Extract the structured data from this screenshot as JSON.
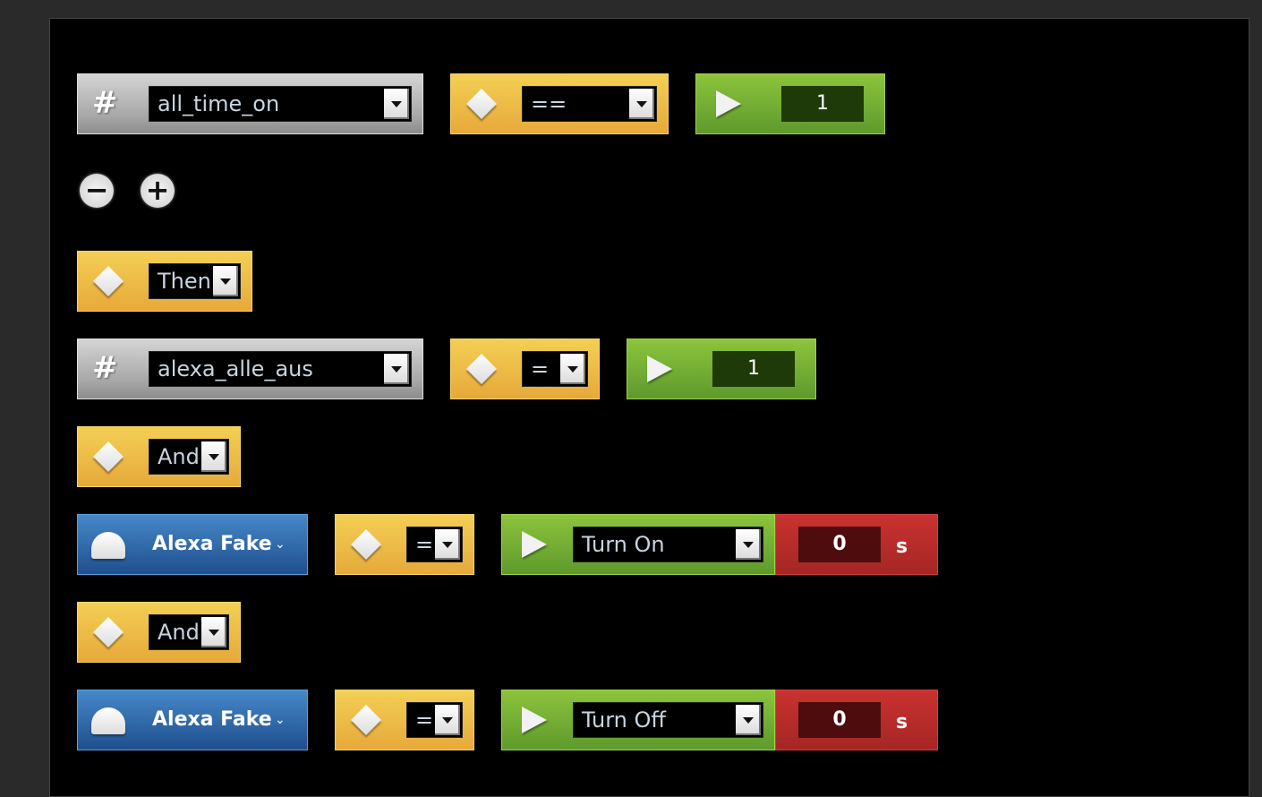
{
  "rows": [
    {
      "type": "condition",
      "variable": "all_time_on",
      "operator": "==",
      "value": "1"
    },
    {
      "type": "logic",
      "value": "Then"
    },
    {
      "type": "condition",
      "variable": "alexa_alle_aus",
      "operator": "=",
      "value": "1"
    },
    {
      "type": "logic",
      "value": "And"
    },
    {
      "type": "device",
      "device": "Alexa Fake",
      "operator": "=",
      "action": "Turn On",
      "delay": "0",
      "unit": "s"
    },
    {
      "type": "logic",
      "value": "And"
    },
    {
      "type": "device",
      "device": "Alexa Fake",
      "operator": "=",
      "action": "Turn Off",
      "delay": "0",
      "unit": "s"
    }
  ],
  "controls": {
    "remove": "−",
    "add": "+"
  },
  "icons": {
    "variable": "hash-icon",
    "operator": "diamond-icon",
    "value": "play-icon",
    "device": "dome-icon"
  },
  "colors": {
    "gray": "#b0b0b0",
    "yellow": "#eebc48",
    "green": "#76b034",
    "red": "#b82c2a",
    "blue": "#2e69ab"
  }
}
